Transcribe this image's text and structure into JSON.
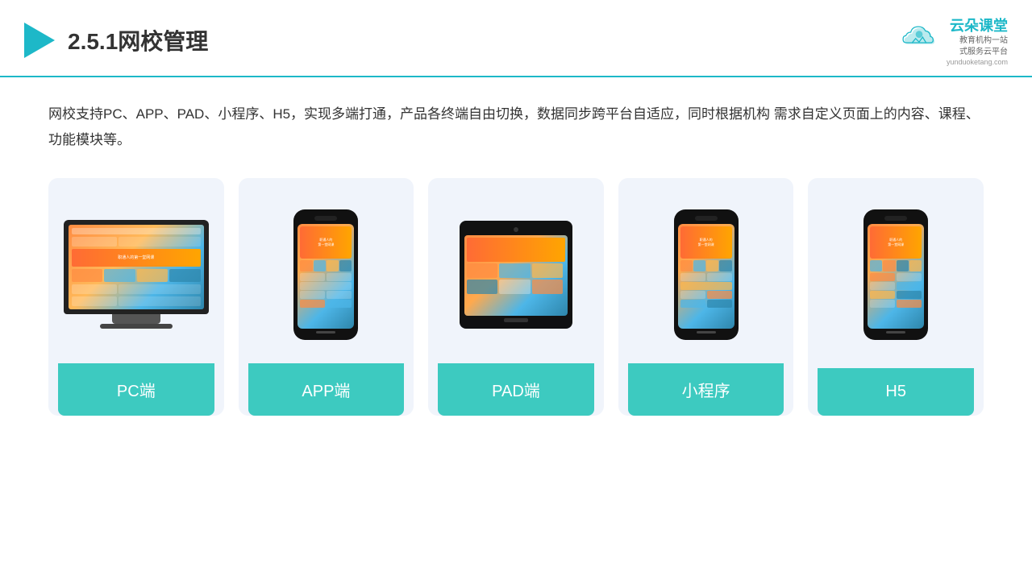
{
  "header": {
    "title": "2.5.1网校管理",
    "brand_name": "云朵课堂",
    "brand_tagline": "教育机构一站\n式服务云平台",
    "brand_url": "yunduoketang.com"
  },
  "description": "网校支持PC、APP、PAD、小程序、H5，实现多端打通，产品各终端自由切换，数据同步跨平台自适应，同时根据机构\n需求自定义页面上的内容、课程、功能模块等。",
  "cards": [
    {
      "id": "pc",
      "label": "PC端"
    },
    {
      "id": "app",
      "label": "APP端"
    },
    {
      "id": "pad",
      "label": "PAD端"
    },
    {
      "id": "miniprogram",
      "label": "小程序"
    },
    {
      "id": "h5",
      "label": "H5"
    }
  ],
  "accent_color": "#3dcac0",
  "teal_color": "#1db8c8"
}
